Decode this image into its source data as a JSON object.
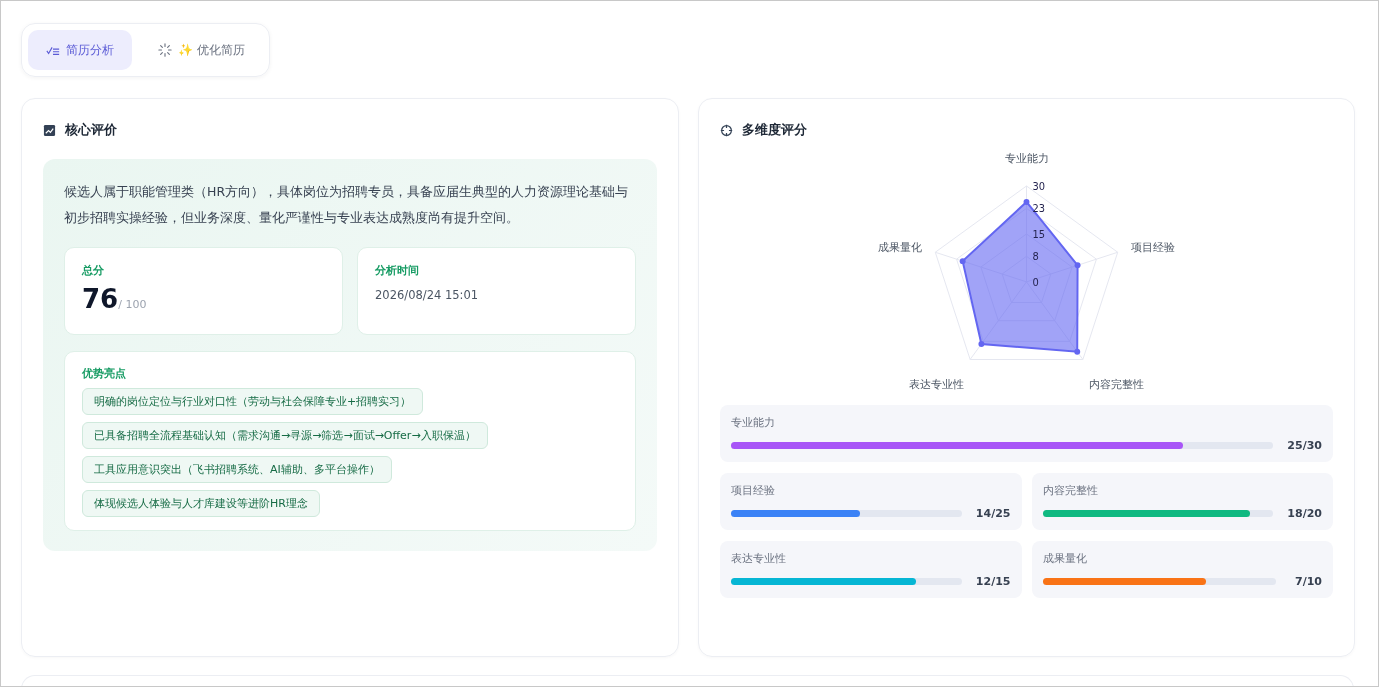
{
  "tabs": [
    {
      "label": "简历分析",
      "kind": "analysis",
      "selected": true
    },
    {
      "label": "✨ 优化简历",
      "kind": "optimize",
      "selected": false
    }
  ],
  "core": {
    "title": "核心评价",
    "summary": "候选人属于职能管理类（HR方向），具体岗位为招聘专员，具备应届生典型的人力资源理论基础与初步招聘实操经验，但业务深度、量化严谨性与专业表达成熟度尚有提升空间。",
    "score": {
      "label": "总分",
      "value": "76",
      "max": "/ 100"
    },
    "time": {
      "label": "分析时间",
      "value": "2026/08/24 15:01"
    },
    "highlights": {
      "title": "优势亮点",
      "items": [
        "明确的岗位定位与行业对口性（劳动与社会保障专业+招聘实习）",
        "已具备招聘全流程基础认知（需求沟通→寻源→筛选→面试→Offer→入职保温）",
        "工具应用意识突出（飞书招聘系统、AI辅助、多平台操作）",
        "体现候选人体验与人才库建设等进阶HR理念"
      ]
    }
  },
  "dimensions": {
    "title": "多维度评分",
    "chart_data": {
      "type": "radar",
      "categories": [
        "专业能力",
        "项目经验",
        "内容完整性",
        "表达专业性",
        "成果量化"
      ],
      "series": [
        {
          "color": "#6366f1",
          "values": [
            25,
            16.8,
            27,
            24,
            21
          ]
        }
      ],
      "ylim": [
        0,
        30
      ],
      "yticks": [
        0,
        8,
        15,
        23,
        30
      ]
    },
    "bars": [
      {
        "label": "专业能力",
        "score": "25/30",
        "level": 0.833,
        "color": "#a855f7"
      },
      {
        "label": "项目经验",
        "score": "14/25",
        "level": 0.56,
        "color": "#3b82f6"
      },
      {
        "label": "内容完整性",
        "score": "18/20",
        "level": 0.9,
        "color": "#10b981"
      },
      {
        "label": "表达专业性",
        "score": "12/15",
        "level": 0.8,
        "color": "#06b6d4"
      },
      {
        "label": "成果量化",
        "score": "7/10",
        "level": 0.7,
        "color": "#f97316"
      }
    ]
  }
}
